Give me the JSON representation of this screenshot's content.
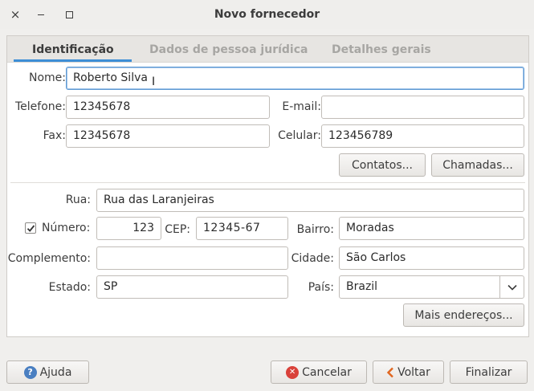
{
  "window": {
    "title": "Novo fornecedor",
    "close_glyph": "×",
    "minimize_glyph": "–"
  },
  "tabs": [
    {
      "label": "Identificação",
      "active": true
    },
    {
      "label": "Dados de pessoa jurídica",
      "active": false
    },
    {
      "label": "Detalhes gerais",
      "active": false
    }
  ],
  "contact": {
    "nome_label": "Nome:",
    "nome_value": "Roberto Silva",
    "telefone_label": "Telefone:",
    "telefone_value": "12345678",
    "email_label": "E-mail:",
    "email_value": "",
    "fax_label": "Fax:",
    "fax_value": "12345678",
    "celular_label": "Celular:",
    "celular_value": "123456789",
    "contatos_button": "Contatos...",
    "chamadas_button": "Chamadas..."
  },
  "address": {
    "rua_label": "Rua:",
    "rua_value": "Rua das Laranjeiras",
    "numero_label": "Número:",
    "numero_checked": true,
    "numero_value": "123",
    "cep_label": "CEP:",
    "cep_value": "12345-67",
    "bairro_label": "Bairro:",
    "bairro_value": "Moradas",
    "complemento_label": "Complemento:",
    "complemento_value": "",
    "cidade_label": "Cidade:",
    "cidade_value": "São Carlos",
    "estado_label": "Estado:",
    "estado_value": "SP",
    "pais_label": "País:",
    "pais_value": "Brazil",
    "mais_enderecos_button": "Mais endereços..."
  },
  "footer": {
    "ajuda": "Ajuda",
    "cancelar": "Cancelar",
    "voltar": "Voltar",
    "finalizar": "Finalizar"
  },
  "colors": {
    "tab_accent": "#3d8ed6",
    "help_icon": "#4a7fc1",
    "cancel_icon": "#d9413a",
    "back_icon": "#e0661f"
  }
}
